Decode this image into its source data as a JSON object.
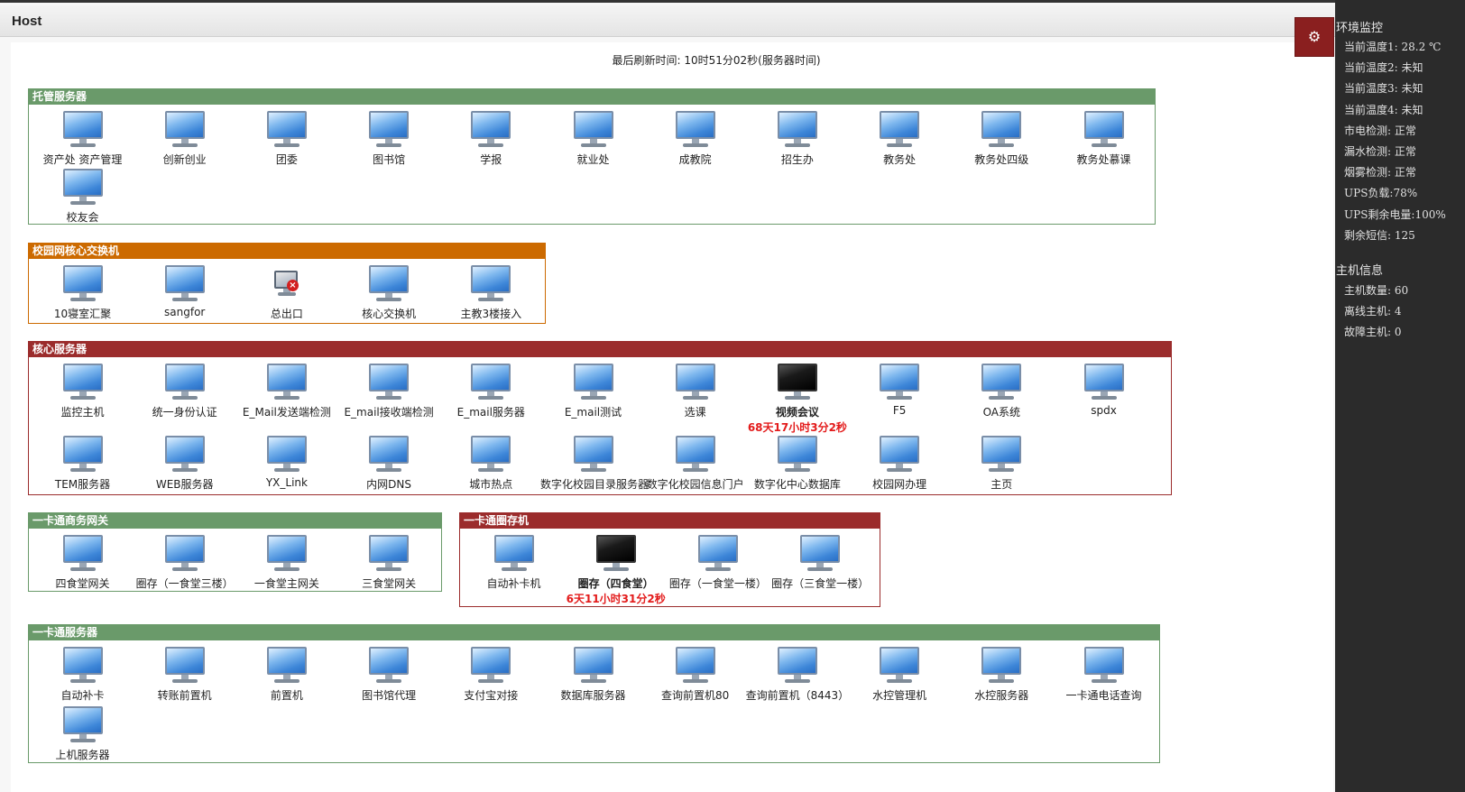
{
  "header": {
    "title": "Host"
  },
  "refresh": {
    "text": "最后刷新时间: 10时51分02秒(服务器时间)"
  },
  "groups": [
    {
      "title": "托管服务器",
      "color": "#6a9a6a",
      "hosts": [
        {
          "label": "资产处 资产管理",
          "status": "ok"
        },
        {
          "label": "创新创业",
          "status": "ok"
        },
        {
          "label": "团委",
          "status": "ok"
        },
        {
          "label": "图书馆",
          "status": "ok"
        },
        {
          "label": "学报",
          "status": "ok"
        },
        {
          "label": "就业处",
          "status": "ok"
        },
        {
          "label": "成教院",
          "status": "ok"
        },
        {
          "label": "招生办",
          "status": "ok"
        },
        {
          "label": "教务处",
          "status": "ok"
        },
        {
          "label": "教务处四级",
          "status": "ok"
        },
        {
          "label": "教务处慕课",
          "status": "ok"
        },
        {
          "label": "校友会",
          "status": "ok"
        }
      ]
    },
    {
      "title": "校园网核心交换机",
      "color": "#cc6a00",
      "hosts": [
        {
          "label": "10寝室汇聚",
          "status": "ok"
        },
        {
          "label": "sangfor",
          "status": "ok"
        },
        {
          "label": "总出口",
          "status": "error"
        },
        {
          "label": "核心交换机",
          "status": "ok"
        },
        {
          "label": "主教3楼接入",
          "status": "ok"
        }
      ]
    },
    {
      "title": "核心服务器",
      "color": "#9b2c2c",
      "hosts": [
        {
          "label": "监控主机",
          "status": "ok"
        },
        {
          "label": "统一身份认证",
          "status": "ok"
        },
        {
          "label": "E_Mail发送端检测",
          "status": "ok"
        },
        {
          "label": "E_mail接收端检测",
          "status": "ok"
        },
        {
          "label": "E_mail服务器",
          "status": "ok"
        },
        {
          "label": "E_mail测试",
          "status": "ok"
        },
        {
          "label": "选课",
          "status": "ok"
        },
        {
          "label": "视频会议",
          "status": "offline",
          "downtime": "68天17小时3分2秒"
        },
        {
          "label": "F5",
          "status": "ok"
        },
        {
          "label": "OA系统",
          "status": "ok"
        },
        {
          "label": "spdx",
          "status": "ok"
        },
        {
          "label": "TEM服务器",
          "status": "ok"
        },
        {
          "label": "WEB服务器",
          "status": "ok"
        },
        {
          "label": "YX_Link",
          "status": "ok"
        },
        {
          "label": "内网DNS",
          "status": "ok"
        },
        {
          "label": "城市热点",
          "status": "ok"
        },
        {
          "label": "数字化校园目录服务器",
          "status": "ok"
        },
        {
          "label": "数字化校园信息门户",
          "status": "ok"
        },
        {
          "label": "数字化中心数据库",
          "status": "ok"
        },
        {
          "label": "校园网办理",
          "status": "ok"
        },
        {
          "label": "主页",
          "status": "ok"
        }
      ]
    },
    {
      "title": "一卡通商务网关",
      "color": "#6a9a6a",
      "hosts": [
        {
          "label": "四食堂网关",
          "status": "ok"
        },
        {
          "label": "圈存（一食堂三楼）",
          "status": "ok"
        },
        {
          "label": "一食堂主网关",
          "status": "ok"
        },
        {
          "label": "三食堂网关",
          "status": "ok"
        }
      ]
    },
    {
      "title": "一卡通圈存机",
      "color": "#9b2c2c",
      "hosts": [
        {
          "label": "自动补卡机",
          "status": "ok"
        },
        {
          "label": "圈存（四食堂）",
          "status": "offline",
          "downtime": "6天11小时31分2秒"
        },
        {
          "label": "圈存（一食堂一楼）",
          "status": "ok"
        },
        {
          "label": "圈存（三食堂一楼）",
          "status": "ok"
        }
      ]
    },
    {
      "title": "一卡通服务器",
      "color": "#6a9a6a",
      "hosts": [
        {
          "label": "自动补卡",
          "status": "ok"
        },
        {
          "label": "转账前置机",
          "status": "ok"
        },
        {
          "label": "前置机",
          "status": "ok"
        },
        {
          "label": "图书馆代理",
          "status": "ok"
        },
        {
          "label": "支付宝对接",
          "status": "ok"
        },
        {
          "label": "数据库服务器",
          "status": "ok"
        },
        {
          "label": "查询前置机80",
          "status": "ok"
        },
        {
          "label": "查询前置机（8443）",
          "status": "ok"
        },
        {
          "label": "水控管理机",
          "status": "ok"
        },
        {
          "label": "水控服务器",
          "status": "ok"
        },
        {
          "label": "一卡通电话查询",
          "status": "ok"
        },
        {
          "label": "上机服务器",
          "status": "ok"
        }
      ]
    }
  ],
  "env_monitor": {
    "title": "环境监控",
    "rows": [
      "当前温度1: 28.2 ℃",
      "当前温度2: 未知",
      "当前温度3: 未知",
      "当前温度4: 未知",
      "市电检测: 正常",
      "漏水检测: 正常",
      "烟雾检测: 正常",
      "UPS负载:78%",
      "UPS剩余电量:100%",
      "剩余短信: 125"
    ]
  },
  "host_info": {
    "title": "主机信息",
    "rows": [
      "主机数量: 60",
      "离线主机: 4",
      "故障主机: 0"
    ]
  },
  "icons": {
    "settings": "gears-icon",
    "monitor": "monitor-icon"
  }
}
